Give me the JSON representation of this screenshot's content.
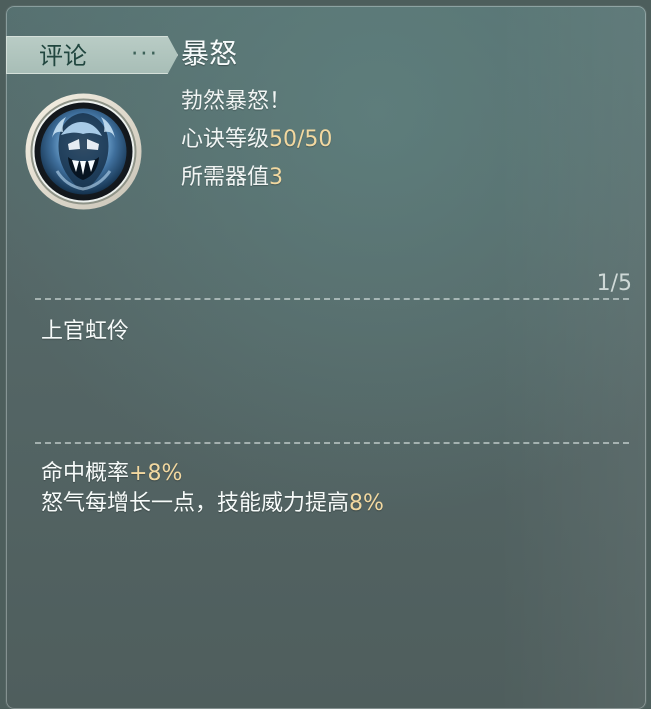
{
  "header": {
    "tab_label": "评论",
    "tab_ellipsis": "···",
    "skill_title": "暴怒"
  },
  "skill": {
    "description": "勃然暴怒！",
    "level_prefix": "心诀等级",
    "level_value": "50/50",
    "cost_prefix": "所需器值",
    "cost_value": "3"
  },
  "review": {
    "page_indicator": "1/5",
    "reviewer_name": "上官虹伶"
  },
  "effects": {
    "hit_prefix": "命中概率",
    "hit_value": "+8%",
    "power_prefix": "怒气每增长一点，技能威力提高",
    "power_value": "8%"
  },
  "icons": {
    "skill_icon": "fanged-mask-icon"
  },
  "colors": {
    "accent": "#f2d8a0",
    "panel": "#546867",
    "tab": "#b9ccc5"
  }
}
